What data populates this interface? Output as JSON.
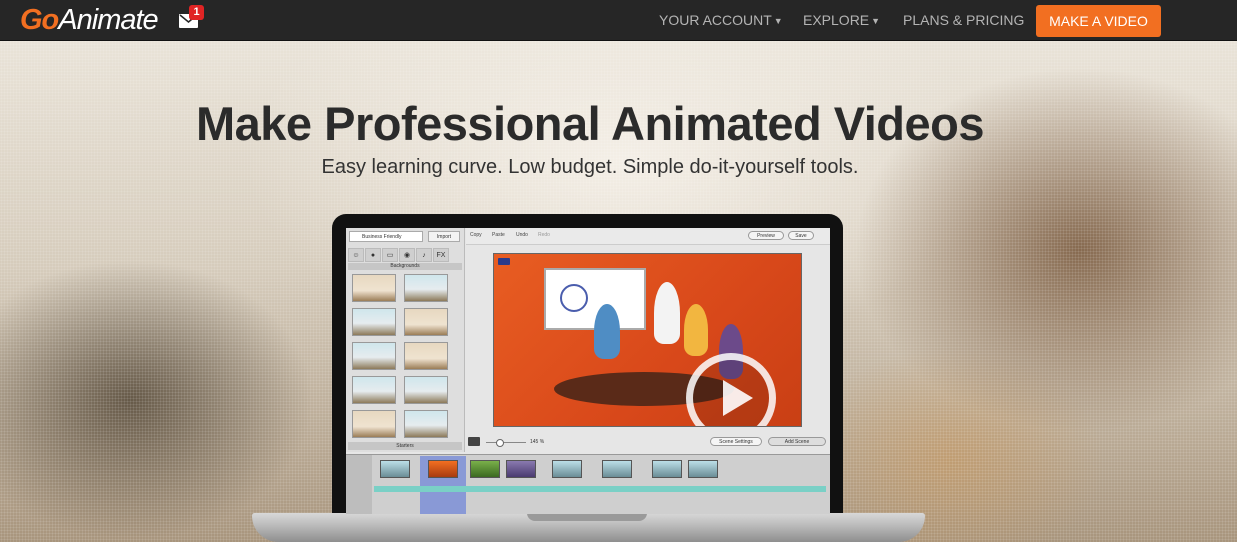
{
  "nav": {
    "logo_go": "Go",
    "logo_animate": "Animate",
    "notification_count": "1",
    "your_account": "YOUR ACCOUNT",
    "explore": "EXPLORE",
    "plans_pricing": "PLANS & PRICING",
    "make_video": "MAKE A VIDEO"
  },
  "hero": {
    "headline": "Make Professional Animated Videos",
    "subhead": "Easy learning curve. Low budget. Simple do-it-yourself tools."
  },
  "editor": {
    "theme_select": "Business Friendly",
    "import_label": "Import",
    "tab_fx": "FX",
    "backgrounds_label": "Backgrounds",
    "starters_label": "Starters",
    "toolbar": {
      "copy": "Copy",
      "paste": "Paste",
      "undo": "Undo",
      "redo": "Redo",
      "preview": "Preview",
      "save": "Save"
    },
    "zoom_level": "145 %",
    "scene_settings": "Scene Settings",
    "add_scene": "Add Scene"
  },
  "colors": {
    "brand_orange": "#f26f21",
    "nav_bg": "#262626",
    "nav_text": "#b4b4b4"
  },
  "icons": [
    "envelope-icon",
    "caret-down-icon",
    "play-icon",
    "camera-icon"
  ]
}
